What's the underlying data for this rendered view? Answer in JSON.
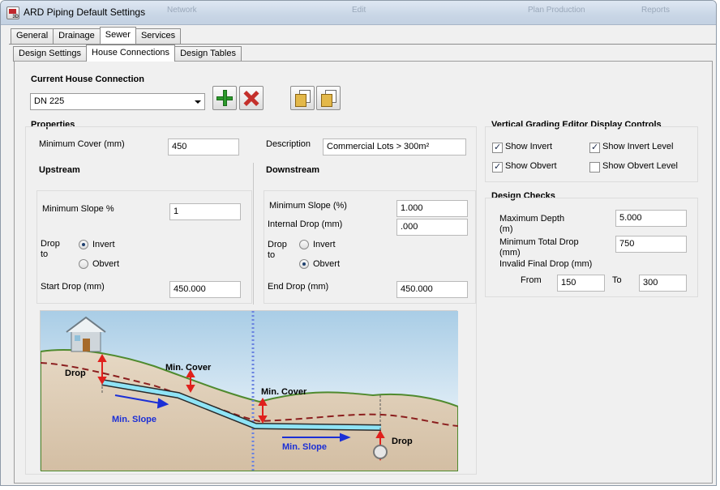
{
  "window": {
    "title": "ARD Piping Default Settings"
  },
  "ghost_titlebar": [
    "Network",
    "Edit",
    "Plan Production",
    "Reports"
  ],
  "tabs_main": [
    {
      "label": "General"
    },
    {
      "label": "Drainage"
    },
    {
      "label": "Sewer",
      "active": true
    },
    {
      "label": "Services"
    }
  ],
  "tabs_sub": [
    {
      "label": "Design Settings"
    },
    {
      "label": "House Connections",
      "active": true
    },
    {
      "label": "Design Tables"
    }
  ],
  "current_connection": {
    "heading": "Current House Connection",
    "value": "DN 225"
  },
  "properties": {
    "heading": "Properties",
    "min_cover_label": "Minimum Cover (mm)",
    "min_cover_value": "450",
    "description_label": "Description",
    "description_value": "Commercial Lots > 300m²"
  },
  "upstream": {
    "heading": "Upstream",
    "min_slope_label": "Minimum Slope %",
    "min_slope_value": "1",
    "drop_to_label_1": "Drop",
    "drop_to_label_2": "to",
    "opt_invert": "Invert",
    "opt_obvert": "Obvert",
    "selected": "Invert",
    "start_drop_label": "Start Drop (mm)",
    "start_drop_value": "450.000"
  },
  "downstream": {
    "heading": "Downstream",
    "min_slope_label": "Minimum Slope (%)",
    "min_slope_value": "1.000",
    "internal_drop_label": "Internal Drop (mm)",
    "internal_drop_value": ".000",
    "drop_to_label_1": "Drop",
    "drop_to_label_2": "to",
    "opt_invert": "Invert",
    "opt_obvert": "Obvert",
    "selected": "Obvert",
    "end_drop_label": "End Drop (mm)",
    "end_drop_value": "450.000"
  },
  "vged": {
    "heading": "Vertical Grading Editor Display Controls",
    "show_invert": {
      "label": "Show Invert",
      "checked": true
    },
    "show_invert_level": {
      "label": "Show Invert Level",
      "checked": true
    },
    "show_obvert": {
      "label": "Show Obvert",
      "checked": true
    },
    "show_obvert_level": {
      "label": "Show Obvert Level",
      "checked": false
    }
  },
  "design_checks": {
    "heading": "Design Checks",
    "max_depth_label_1": "Maximum Depth",
    "max_depth_label_2": "(m)",
    "max_depth_value": "5.000",
    "min_total_drop_label_1": "Minimum Total Drop",
    "min_total_drop_label_2": "(mm)",
    "min_total_drop_value": "750",
    "invalid_final_drop_label": "Invalid Final Drop (mm)",
    "from_label": "From",
    "from_value": "150",
    "to_label": "To",
    "to_value": "300"
  },
  "diagram": {
    "labels": {
      "drop_left": "Drop",
      "min_cover_1": "Min. Cover",
      "min_cover_2": "Min. Cover",
      "min_slope_1": "Min. Slope",
      "min_slope_2": "Min. Slope",
      "drop_right": "Drop"
    }
  },
  "colors": {
    "sky_top": "#a9cde6",
    "grass": "#4f8a2e",
    "soil": "#d9c7b1",
    "pipe": "#4fc8e8",
    "arrow_red": "#e0201c",
    "arrow_blue": "#1b2fd6",
    "slope_text": "#1b2fd6"
  }
}
